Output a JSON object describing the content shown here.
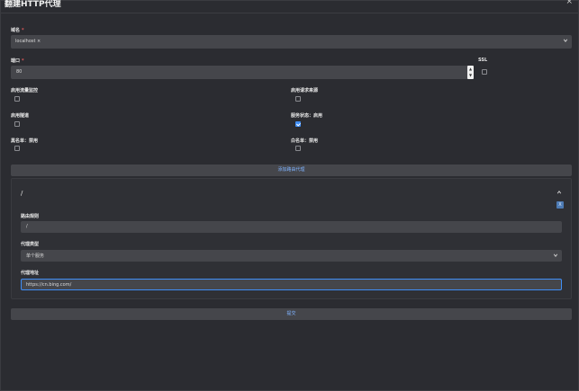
{
  "dialog": {
    "title": "翻建HTTP代理",
    "close_glyph": "×"
  },
  "domain": {
    "label": "域名",
    "required_mark": "*",
    "chip": "localhost ×"
  },
  "port": {
    "label": "端口",
    "required_mark": "*",
    "value": "80",
    "spin_up": "▲",
    "spin_down": "▼"
  },
  "ssl": {
    "label": "SSL",
    "checked": false
  },
  "toggles": {
    "traffic_monitor": {
      "label": "启用流量监控",
      "checked": false
    },
    "request_source": {
      "label": "启用请求来源",
      "checked": false
    },
    "tunnel": {
      "label": "启用隧道",
      "checked": false
    },
    "service_status": {
      "label": "服务状态：启用",
      "checked": true
    },
    "blacklist": {
      "label": "黑名单：禁用",
      "checked": false
    },
    "whitelist": {
      "label": "白名单：禁用",
      "checked": false
    }
  },
  "add_route_button": "添加路由代理",
  "route": {
    "path_title": "/",
    "remove_glyph": "X",
    "route_rule_label": "路由规则",
    "route_rule_value": "/",
    "proxy_type_label": "代理类型",
    "proxy_type_value": "单个服务",
    "proxy_address_label": "代理地址",
    "proxy_address_value": "https://cn.bing.com/"
  },
  "submit_button": "提交",
  "colors": {
    "accent": "#3f8ef7",
    "field_bg": "#45464b",
    "dialog_bg": "#2b2c31",
    "link_text": "#7fb3ff"
  }
}
